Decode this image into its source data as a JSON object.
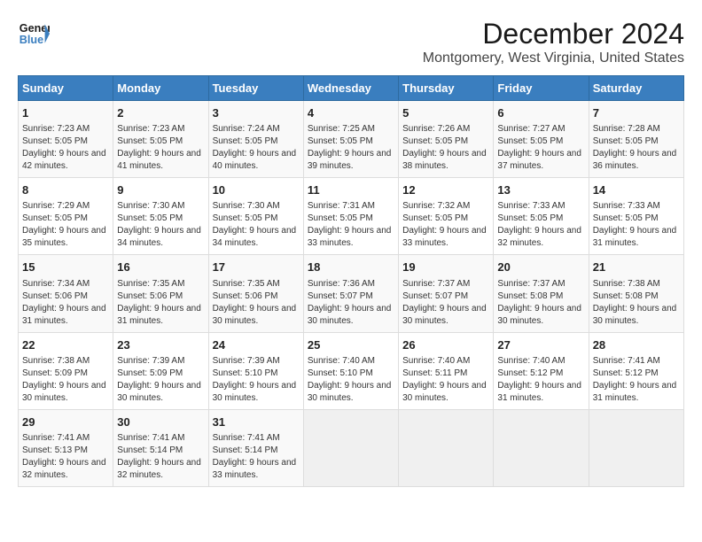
{
  "logo": {
    "line1": "General",
    "line2": "Blue"
  },
  "title": "December 2024",
  "subtitle": "Montgomery, West Virginia, United States",
  "days_header": [
    "Sunday",
    "Monday",
    "Tuesday",
    "Wednesday",
    "Thursday",
    "Friday",
    "Saturday"
  ],
  "weeks": [
    [
      {
        "day": "1",
        "sunrise": "7:23 AM",
        "sunset": "5:05 PM",
        "daylight": "9 hours and 42 minutes."
      },
      {
        "day": "2",
        "sunrise": "7:23 AM",
        "sunset": "5:05 PM",
        "daylight": "9 hours and 41 minutes."
      },
      {
        "day": "3",
        "sunrise": "7:24 AM",
        "sunset": "5:05 PM",
        "daylight": "9 hours and 40 minutes."
      },
      {
        "day": "4",
        "sunrise": "7:25 AM",
        "sunset": "5:05 PM",
        "daylight": "9 hours and 39 minutes."
      },
      {
        "day": "5",
        "sunrise": "7:26 AM",
        "sunset": "5:05 PM",
        "daylight": "9 hours and 38 minutes."
      },
      {
        "day": "6",
        "sunrise": "7:27 AM",
        "sunset": "5:05 PM",
        "daylight": "9 hours and 37 minutes."
      },
      {
        "day": "7",
        "sunrise": "7:28 AM",
        "sunset": "5:05 PM",
        "daylight": "9 hours and 36 minutes."
      }
    ],
    [
      {
        "day": "8",
        "sunrise": "7:29 AM",
        "sunset": "5:05 PM",
        "daylight": "9 hours and 35 minutes."
      },
      {
        "day": "9",
        "sunrise": "7:30 AM",
        "sunset": "5:05 PM",
        "daylight": "9 hours and 34 minutes."
      },
      {
        "day": "10",
        "sunrise": "7:30 AM",
        "sunset": "5:05 PM",
        "daylight": "9 hours and 34 minutes."
      },
      {
        "day": "11",
        "sunrise": "7:31 AM",
        "sunset": "5:05 PM",
        "daylight": "9 hours and 33 minutes."
      },
      {
        "day": "12",
        "sunrise": "7:32 AM",
        "sunset": "5:05 PM",
        "daylight": "9 hours and 33 minutes."
      },
      {
        "day": "13",
        "sunrise": "7:33 AM",
        "sunset": "5:05 PM",
        "daylight": "9 hours and 32 minutes."
      },
      {
        "day": "14",
        "sunrise": "7:33 AM",
        "sunset": "5:05 PM",
        "daylight": "9 hours and 31 minutes."
      }
    ],
    [
      {
        "day": "15",
        "sunrise": "7:34 AM",
        "sunset": "5:06 PM",
        "daylight": "9 hours and 31 minutes."
      },
      {
        "day": "16",
        "sunrise": "7:35 AM",
        "sunset": "5:06 PM",
        "daylight": "9 hours and 31 minutes."
      },
      {
        "day": "17",
        "sunrise": "7:35 AM",
        "sunset": "5:06 PM",
        "daylight": "9 hours and 30 minutes."
      },
      {
        "day": "18",
        "sunrise": "7:36 AM",
        "sunset": "5:07 PM",
        "daylight": "9 hours and 30 minutes."
      },
      {
        "day": "19",
        "sunrise": "7:37 AM",
        "sunset": "5:07 PM",
        "daylight": "9 hours and 30 minutes."
      },
      {
        "day": "20",
        "sunrise": "7:37 AM",
        "sunset": "5:08 PM",
        "daylight": "9 hours and 30 minutes."
      },
      {
        "day": "21",
        "sunrise": "7:38 AM",
        "sunset": "5:08 PM",
        "daylight": "9 hours and 30 minutes."
      }
    ],
    [
      {
        "day": "22",
        "sunrise": "7:38 AM",
        "sunset": "5:09 PM",
        "daylight": "9 hours and 30 minutes."
      },
      {
        "day": "23",
        "sunrise": "7:39 AM",
        "sunset": "5:09 PM",
        "daylight": "9 hours and 30 minutes."
      },
      {
        "day": "24",
        "sunrise": "7:39 AM",
        "sunset": "5:10 PM",
        "daylight": "9 hours and 30 minutes."
      },
      {
        "day": "25",
        "sunrise": "7:40 AM",
        "sunset": "5:10 PM",
        "daylight": "9 hours and 30 minutes."
      },
      {
        "day": "26",
        "sunrise": "7:40 AM",
        "sunset": "5:11 PM",
        "daylight": "9 hours and 30 minutes."
      },
      {
        "day": "27",
        "sunrise": "7:40 AM",
        "sunset": "5:12 PM",
        "daylight": "9 hours and 31 minutes."
      },
      {
        "day": "28",
        "sunrise": "7:41 AM",
        "sunset": "5:12 PM",
        "daylight": "9 hours and 31 minutes."
      }
    ],
    [
      {
        "day": "29",
        "sunrise": "7:41 AM",
        "sunset": "5:13 PM",
        "daylight": "9 hours and 32 minutes."
      },
      {
        "day": "30",
        "sunrise": "7:41 AM",
        "sunset": "5:14 PM",
        "daylight": "9 hours and 32 minutes."
      },
      {
        "day": "31",
        "sunrise": "7:41 AM",
        "sunset": "5:14 PM",
        "daylight": "9 hours and 33 minutes."
      },
      null,
      null,
      null,
      null
    ]
  ],
  "labels": {
    "sunrise": "Sunrise:",
    "sunset": "Sunset:",
    "daylight": "Daylight:"
  }
}
